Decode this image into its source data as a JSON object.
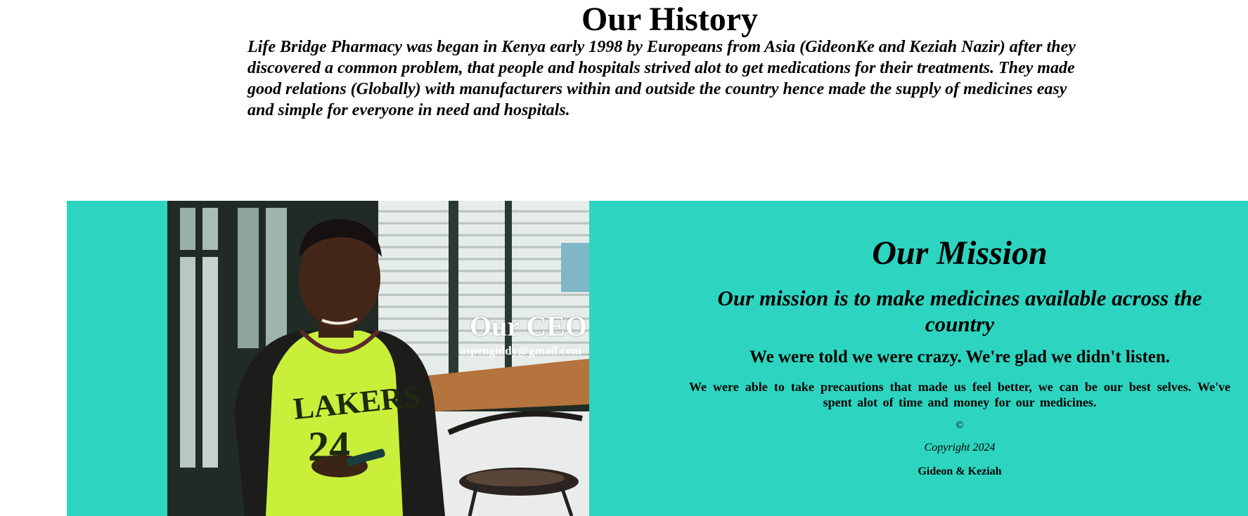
{
  "history": {
    "title": "Our History",
    "text": "Life Bridge Pharmacy was began in Kenya early 1998 by Europeans from Asia (GideonKe and Keziah Nazir) after they discovered a common problem, that people and hospitals strived alot to get medications for their treatments. They made good relations (Globally) with manufacturers within and outside the country hence made the supply of medicines easy and simple for everyone in need and hospitals."
  },
  "ceo": {
    "title": "Our CEO",
    "email": "aspengiddy@gmail.com"
  },
  "mission": {
    "title": "Our Mission",
    "statement": "Our mission is to make medicines available across the country",
    "tagline": "We were told we were crazy. We're glad we didn't listen.",
    "body": "We were able to take precautions that made us feel better, we can be our best selves. We've spent alot of time and money for our medicines."
  },
  "footer": {
    "copy_symbol": "©",
    "copyright": "Copyright 2024",
    "authors": "Gideon & Keziah"
  },
  "colors": {
    "mission_background": "#2dd5c0",
    "page_background": "#ffffff",
    "text": "#000000",
    "ceo_text": "#ffffff"
  }
}
